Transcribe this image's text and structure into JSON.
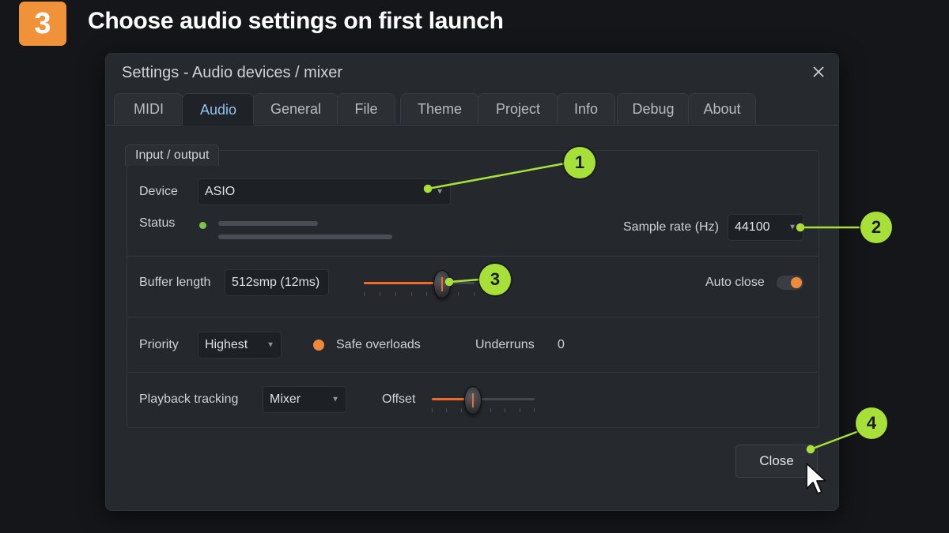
{
  "step": {
    "number": "3",
    "title": "Choose audio settings on first launch"
  },
  "dialog": {
    "title": "Settings - Audio devices / mixer",
    "tabs": [
      "MIDI",
      "Audio",
      "General",
      "File",
      "Theme",
      "Project",
      "Info",
      "Debug",
      "About"
    ],
    "active_tab": "Audio",
    "group_label": "Input / output",
    "device": {
      "label": "Device",
      "value": "ASIO"
    },
    "status": {
      "label": "Status"
    },
    "sample_rate": {
      "label": "Sample rate (Hz)",
      "value": "44100"
    },
    "buffer": {
      "label": "Buffer length",
      "value": "512smp (12ms)",
      "slider_fraction": 0.7
    },
    "auto_close": {
      "label": "Auto close",
      "enabled": true
    },
    "priority": {
      "label": "Priority",
      "value": "Highest"
    },
    "safe_overloads": {
      "label": "Safe overloads",
      "enabled": true
    },
    "underruns": {
      "label": "Underruns",
      "value": "0"
    },
    "playback_tracking": {
      "label": "Playback tracking",
      "value": "Mixer"
    },
    "offset": {
      "label": "Offset",
      "slider_fraction": 0.39
    },
    "close_button": "Close"
  },
  "callouts": [
    "1",
    "2",
    "3",
    "4"
  ],
  "colors": {
    "accent_orange": "#f0923a",
    "callout_green": "#a8e03a",
    "active_tab_text": "#8fc2ec"
  }
}
